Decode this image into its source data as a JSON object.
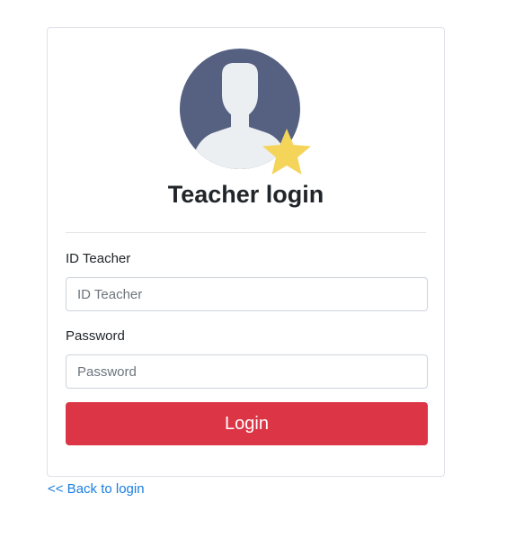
{
  "login_card": {
    "title": "Teacher login",
    "avatar_icon": "teacher-avatar-with-star-icon",
    "id_field": {
      "label": "ID Teacher",
      "placeholder": "ID Teacher",
      "value": ""
    },
    "password_field": {
      "label": "Password",
      "placeholder": "Password",
      "value": ""
    },
    "submit_label": "Login"
  },
  "back_link": "<< Back to login",
  "colors": {
    "primary_button": "#dc3545",
    "link": "#1a7fe0",
    "avatar_background": "#566182",
    "star": "#f5d45a"
  }
}
